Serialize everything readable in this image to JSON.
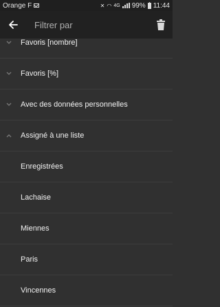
{
  "status_bar": {
    "carrier": "Orange F",
    "network": "4G",
    "battery": "99%",
    "time": "11:44"
  },
  "toolbar": {
    "title": "Filtrer par"
  },
  "filters": [
    {
      "label": "Favoris [nombre]",
      "expanded": false
    },
    {
      "label": "Favoris [%]",
      "expanded": false
    },
    {
      "label": "Avec des données personnelles",
      "expanded": false
    },
    {
      "label": "Assigné à une liste",
      "expanded": true
    }
  ],
  "list_options": [
    "Enregistrées",
    "Lachaise",
    "Miennes",
    "Paris",
    "Vincennes"
  ]
}
